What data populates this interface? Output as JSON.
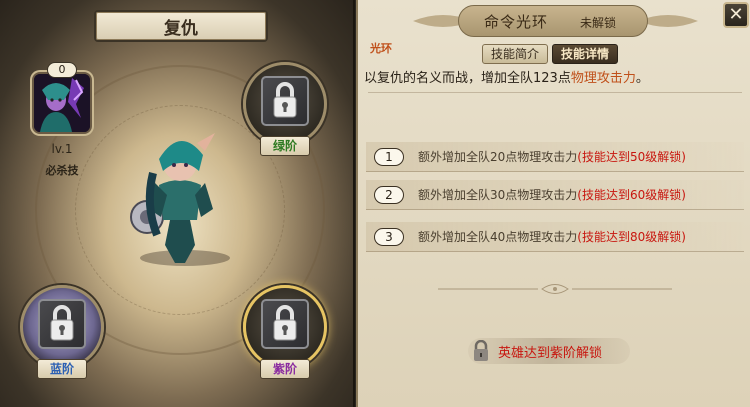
{
  "left": {
    "title": "复仇",
    "skill": {
      "count": "0",
      "level": "lv.1",
      "type": "必杀技"
    },
    "tiers": {
      "green": "绿阶",
      "blue": "蓝阶",
      "purple": "紫阶"
    }
  },
  "right": {
    "title": "命令光环",
    "status": "未解锁",
    "section_tag": "光环",
    "tabs": {
      "intro": "技能简介",
      "detail": "技能详情"
    },
    "description": {
      "prefix": "以复仇的名义而战，增加全队123点",
      "highlight": "物理攻击力",
      "suffix": "。"
    },
    "bonuses": [
      {
        "num": "1",
        "text": "额外增加全队20点物理攻击力",
        "cond": "(技能达到50级解锁)"
      },
      {
        "num": "2",
        "text": "额外增加全队30点物理攻击力",
        "cond": "(技能达到60级解锁)"
      },
      {
        "num": "3",
        "text": "额外增加全队40点物理攻击力",
        "cond": "(技能达到80级解锁)"
      }
    ],
    "unlock_text": "英雄达到紫阶解锁",
    "close_glyph": "✕"
  },
  "colors": {
    "accent_orange": "#c0501a",
    "condition_red": "#c8160f",
    "green_tier": "#2e7a22",
    "blue_tier": "#2b5fb3",
    "purple_tier": "#8a2ba0"
  },
  "icons": [
    "skill-portrait-icon",
    "lock-icon",
    "close-icon"
  ]
}
